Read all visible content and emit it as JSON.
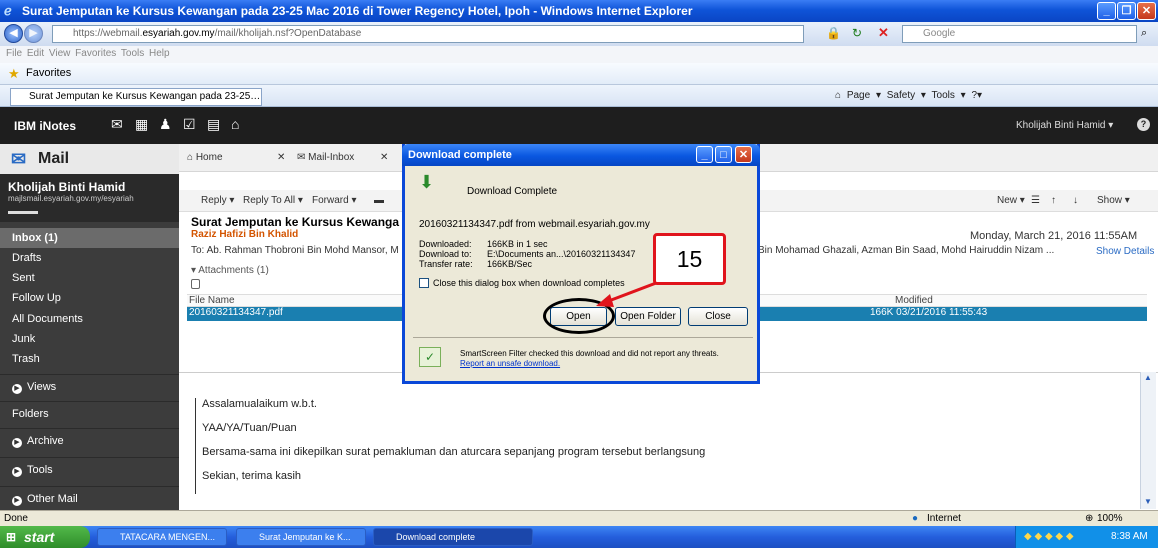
{
  "browser": {
    "title": "Surat Jemputan ke Kursus Kewangan pada 23-25 Mac 2016 di Tower Regency Hotel, Ipoh - Windows Internet Explorer",
    "url_prefix": "https://webmail.",
    "url_domain": "esyariah.gov.my",
    "url_path": "/mail/kholijah.nsf?OpenDatabase",
    "search_placeholder": "Google",
    "menu": "File  Edit  View  Favorites  Tools  Help",
    "favorites_label": "Favorites",
    "tab_title": "Surat Jemputan ke Kursus Kewangan pada 23-25 Mac...",
    "commands": [
      "Page ▾",
      "Safety ▾",
      "Tools ▾"
    ]
  },
  "inotes": {
    "brand": "IBM iNotes",
    "user_menu": "Kholijah Binti Hamid ▾",
    "help_icon": "help-icon"
  },
  "sidebar": {
    "title": "Mail",
    "user_name": "Kholijah Binti Hamid",
    "user_path": "majlsmail.esyariah.gov.my/esyariah",
    "items": [
      {
        "label": "Inbox (1)",
        "selected": true
      },
      {
        "label": "Drafts"
      },
      {
        "label": "Sent"
      },
      {
        "label": "Follow Up"
      },
      {
        "label": "All Documents"
      },
      {
        "label": "Junk"
      },
      {
        "label": "Trash"
      }
    ],
    "sections": [
      "Views",
      "Folders",
      "Archive",
      "Tools",
      "Other Mail"
    ]
  },
  "tabs": [
    {
      "label": "Home"
    },
    {
      "label": "Mail-Inbox"
    }
  ],
  "toolbar": {
    "reply": "Reply ▾",
    "reply_all": "Reply To All ▾",
    "forward": "Forward ▾",
    "new": "New ▾",
    "show": "Show ▾"
  },
  "message": {
    "subject": "Surat Jemputan ke Kursus Kewanga",
    "from": "Raziz Hafizi Bin Khalid",
    "to": "To: Ab. Rahman Thobroni Bin Mohd Mansor, M",
    "to_tail": "Bin Mohamad Ghazali, Azman Bin Saad, Mohd Hairuddin Nizam ...",
    "date": "Monday, March 21, 2016 11:55AM",
    "show_details": "Show Details",
    "attachments_label": "▾ Attachments (1)",
    "file_col": "File Name",
    "modified_col": "Modified",
    "file_name": "20160321134347.pdf",
    "file_info": "166K 03/21/2016 11:55:43",
    "body": [
      "Assalamualaikum w.b.t.",
      "YAA/YA/Tuan/Puan",
      "Bersama-sama ini dikepilkan surat pemakluman dan aturcara sepanjang program tersebut berlangsung",
      "Sekian, terima kasih"
    ]
  },
  "dialog": {
    "title": "Download complete",
    "heading": "Download Complete",
    "source": "20160321134347.pdf from webmail.esyariah.gov.my",
    "downloaded_label": "Downloaded:",
    "downloaded_value": "166KB in 1 sec",
    "download_to_label": "Download to:",
    "download_to_value": "E:\\Documents an...\\20160321134347",
    "transfer_label": "Transfer rate:",
    "transfer_value": "166KB/Sec",
    "close_checkbox": "Close this dialog box when download completes",
    "open": "Open",
    "open_folder": "Open Folder",
    "close": "Close",
    "smartscreen": "SmartScreen Filter checked this download and did not report any threats.",
    "report_link": "Report an unsafe download."
  },
  "annotation": {
    "step": "15",
    "color": "#e0141c"
  },
  "status": {
    "left": "Done",
    "zone": "Internet",
    "zoom": "100%"
  },
  "taskbar": {
    "start": "start",
    "buttons": [
      {
        "label": "TATACARA MENGEN..."
      },
      {
        "label": "Surat Jemputan ke K..."
      },
      {
        "label": "Download complete",
        "active": true
      }
    ],
    "clock": "8:38 AM"
  }
}
